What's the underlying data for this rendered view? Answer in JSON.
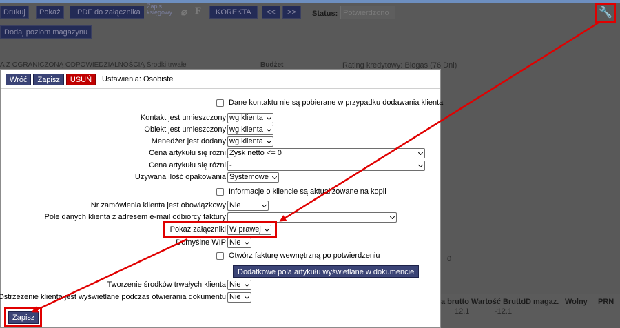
{
  "toolbar": {
    "drukuj": "Drukuj",
    "pokaz": "Pokaż",
    "pdf": "PDF do załącznika",
    "zapis_line1": "Zapis",
    "zapis_line2": "księgowy",
    "f": "F",
    "korekta": "KOREKTA",
    "prev": "<<",
    "next": ">>",
    "dodaj_poziom": "Dodaj poziom magazynu"
  },
  "status": {
    "label": "Status:",
    "value": "Potwierdzono"
  },
  "background": {
    "company": "A Z OGRANICZONĄ ODPOWIEDZIALNOŚCIĄ Środki trwałe",
    "budzet": "Budżet",
    "rating": "Rating kredytowy: Blogas (76 Dni)",
    "zero": "0",
    "grid_headers": [
      "a brutto",
      "Wartość Brutto",
      "ID magaz.",
      "Wolny",
      "PRN"
    ],
    "grid_values": [
      "12.1",
      "-12.1"
    ]
  },
  "modal": {
    "buttons": {
      "back": "Wróć",
      "save": "Zapisz",
      "delete": "USUŃ"
    },
    "title": "Ustawienia: Osobiste",
    "rows": {
      "dane_kontaktu": "Dane kontaktu nie są pobierane w przypadku dodawania klienta",
      "kontakt_label": "Kontakt jest umieszczony",
      "kontakt_value": "wg klienta",
      "obiekt_label": "Obiekt jest umieszczony",
      "obiekt_value": "wg klienta",
      "menedzer_label": "Menedżer jest dodany",
      "menedzer_value": "wg klienta",
      "cena1_label": "Cena artykułu się różni",
      "cena1_value": "Zysk netto <= 0",
      "cena2_label": "Cena artykułu się różni",
      "cena2_value": "-",
      "opak_label": "Używana ilość opakowania",
      "opak_value": "Systemowe",
      "info_kopii": "Informacje o kliencie są aktualizowane na kopii",
      "nr_zam_label": "Nr zamówienia klienta jest obowiązkowy",
      "nr_zam_value": "Nie",
      "pole_label": "Pole danych klienta z adresem e-mail odbiorcy faktury",
      "pole_value": "",
      "zalaczniki_label": "Pokaż załączniki",
      "zalaczniki_value": "W prawej",
      "wip_label": "Domyślne WIP",
      "wip_value": "Nie",
      "otworz": "Otwórz fakturę wewnętrzną po potwierdzeniu",
      "dodatkowe": "Dodatkowe pola artykułu wyświetlane w dokumencie",
      "srodki_label": "Tworzenie środków trwałych klienta",
      "srodki_value": "Nie",
      "ostrz_label": "Ostrzeżenie klienta jest wyświetlane podczas otwierania dokumentu",
      "ostrz_value": "Nie"
    },
    "footer_save": "Zapisz"
  },
  "colors": {
    "highlight": "#e00000",
    "button": "#3b4476",
    "delete": "#c00000"
  },
  "icons": [
    "wrench-icon",
    "paperclip-icon"
  ]
}
